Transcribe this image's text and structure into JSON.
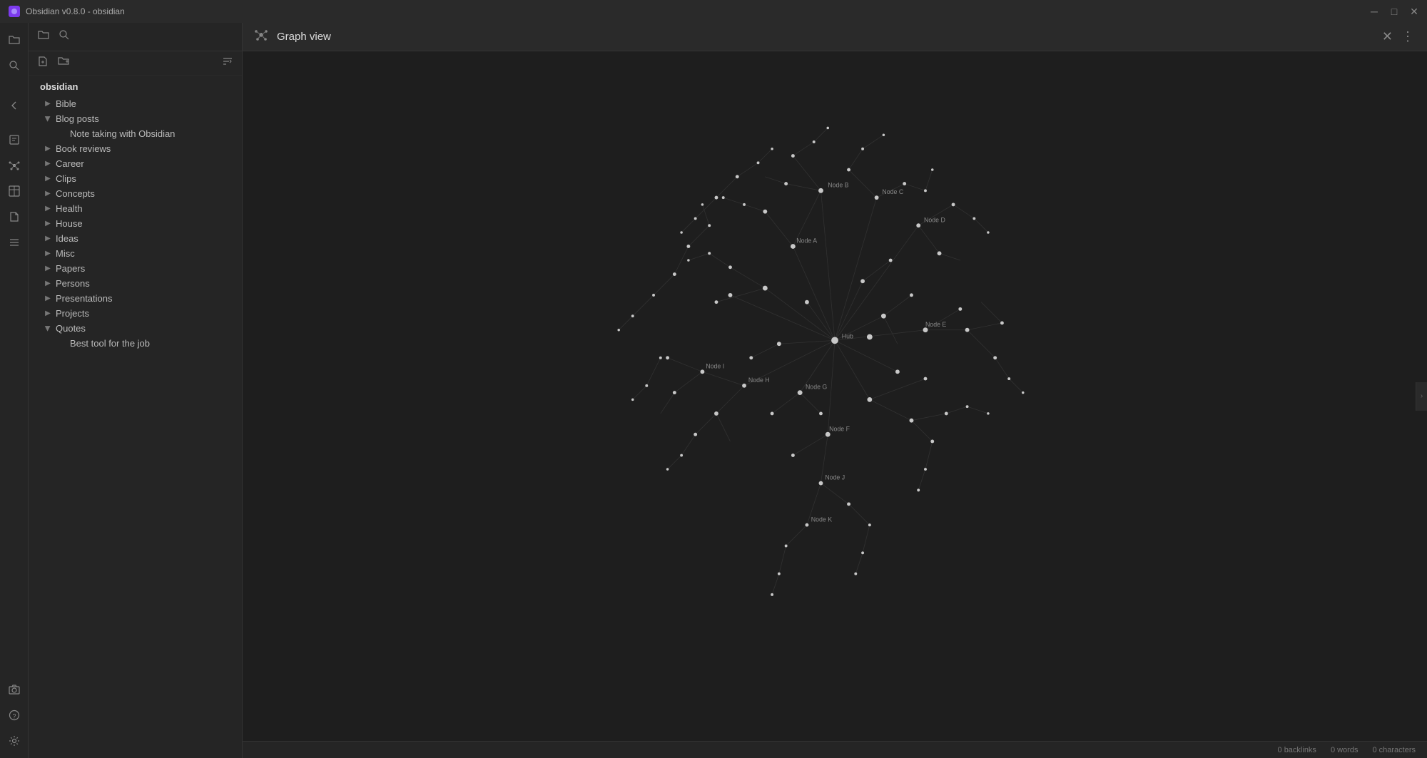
{
  "titlebar": {
    "title": "Obsidian v0.8.0 - obsidian",
    "minimize": "—",
    "maximize": "□",
    "close": "✕"
  },
  "file_panel": {
    "root_label": "obsidian",
    "items": [
      {
        "id": "bible",
        "label": "Bible",
        "type": "folder",
        "open": false,
        "indent": 0
      },
      {
        "id": "blog-posts",
        "label": "Blog posts",
        "type": "folder",
        "open": true,
        "indent": 0
      },
      {
        "id": "note-taking",
        "label": "Note taking with Obsidian",
        "type": "file",
        "indent": 1
      },
      {
        "id": "book-reviews",
        "label": "Book reviews",
        "type": "folder",
        "open": false,
        "indent": 0
      },
      {
        "id": "career",
        "label": "Career",
        "type": "folder",
        "open": false,
        "indent": 0
      },
      {
        "id": "clips",
        "label": "Clips",
        "type": "folder",
        "open": false,
        "indent": 0
      },
      {
        "id": "concepts",
        "label": "Concepts",
        "type": "folder",
        "open": false,
        "indent": 0
      },
      {
        "id": "health",
        "label": "Health",
        "type": "folder",
        "open": false,
        "indent": 0
      },
      {
        "id": "house",
        "label": "House",
        "type": "folder",
        "open": false,
        "indent": 0
      },
      {
        "id": "ideas",
        "label": "Ideas",
        "type": "folder",
        "open": false,
        "indent": 0
      },
      {
        "id": "misc",
        "label": "Misc",
        "type": "folder",
        "open": false,
        "indent": 0
      },
      {
        "id": "papers",
        "label": "Papers",
        "type": "folder",
        "open": false,
        "indent": 0
      },
      {
        "id": "persons",
        "label": "Persons",
        "type": "folder",
        "open": false,
        "indent": 0
      },
      {
        "id": "presentations",
        "label": "Presentations",
        "type": "folder",
        "open": false,
        "indent": 0
      },
      {
        "id": "projects",
        "label": "Projects",
        "type": "folder",
        "open": false,
        "indent": 0
      },
      {
        "id": "quotes",
        "label": "Quotes",
        "type": "folder",
        "open": true,
        "indent": 0
      },
      {
        "id": "best-tool",
        "label": "Best tool for the job",
        "type": "file",
        "indent": 1
      }
    ]
  },
  "graph": {
    "title": "Graph view",
    "icon": "⬡"
  },
  "status_bar": {
    "backlinks": "0 backlinks",
    "words": "0 words",
    "characters": "0 characters"
  },
  "sidebar_icons": [
    {
      "id": "folder-icon",
      "symbol": "🗂",
      "label": "Files"
    },
    {
      "id": "search-icon",
      "symbol": "🔍",
      "label": "Search"
    }
  ],
  "left_icons": [
    {
      "id": "back-icon",
      "symbol": "‹",
      "label": "Back"
    },
    {
      "id": "notes-icon",
      "symbol": "☰",
      "label": "Notes"
    },
    {
      "id": "graph-icon",
      "symbol": "⬡",
      "label": "Graph"
    },
    {
      "id": "table-icon",
      "symbol": "⊞",
      "label": "Table"
    },
    {
      "id": "document-icon",
      "symbol": "📄",
      "label": "Document"
    },
    {
      "id": "stack-icon",
      "symbol": "≡",
      "label": "Stack"
    },
    {
      "id": "camera-icon",
      "symbol": "📷",
      "label": "Camera"
    },
    {
      "id": "help-icon",
      "symbol": "?",
      "label": "Help"
    },
    {
      "id": "settings-icon",
      "symbol": "⚙",
      "label": "Settings"
    }
  ]
}
